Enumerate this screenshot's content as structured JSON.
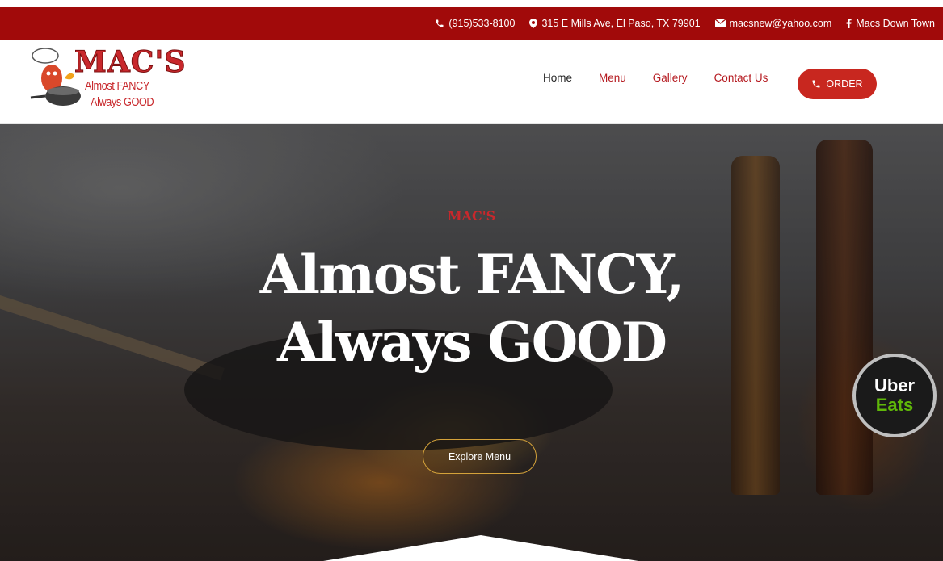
{
  "topbar": {
    "phone": "(915)533-8100",
    "address": "315 E Mills Ave, El Paso, TX 79901",
    "email": "macsnew@yahoo.com",
    "facebook": "Macs Down Town"
  },
  "logo": {
    "title": "MAC'S",
    "line1": "Almost FANCY",
    "line2": "Always GOOD"
  },
  "nav": {
    "items": [
      "Home",
      "Menu",
      "Gallery",
      "Contact Us"
    ],
    "order_label": "ORDER"
  },
  "hero": {
    "brand": "MAC'S",
    "title_line1": "Almost FANCY,",
    "title_line2": "Always GOOD",
    "button": "Explore Menu"
  },
  "uber": {
    "line1": "Uber",
    "line2": "Eats"
  },
  "colors": {
    "topbar": "#a10a0a",
    "accent": "#c8271f",
    "nav_active": "#b5191f",
    "button_border": "#d4a23a",
    "uber_green": "#5fb709"
  },
  "icons": [
    "phone-icon",
    "map-marker-icon",
    "envelope-icon",
    "facebook-icon"
  ]
}
